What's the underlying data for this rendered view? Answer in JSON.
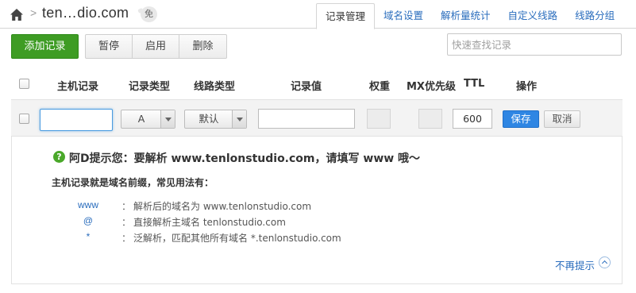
{
  "header": {
    "home_icon": "home-icon",
    "separator": ">",
    "domain": "ten…dio.com",
    "badge": "免",
    "tabs": [
      {
        "label": "记录管理",
        "active": true
      },
      {
        "label": "域名设置",
        "active": false
      },
      {
        "label": "解析量统计",
        "active": false
      },
      {
        "label": "自定义线路",
        "active": false
      },
      {
        "label": "线路分组",
        "active": false
      }
    ]
  },
  "toolbar": {
    "add_label": "添加记录",
    "pause_label": "暂停",
    "enable_label": "启用",
    "delete_label": "删除",
    "search_placeholder": "快速查找记录"
  },
  "table": {
    "headers": {
      "host": "主机记录",
      "type": "记录类型",
      "line": "线路类型",
      "value": "记录值",
      "weight": "权重",
      "mx": "MX优先级",
      "ttl": "TTL",
      "action": "操作"
    }
  },
  "edit_row": {
    "host_value": "",
    "record_type": "A",
    "line_type": "默认",
    "record_value": "",
    "ttl": "600",
    "save_label": "保存",
    "cancel_label": "取消"
  },
  "tip": {
    "icon": "question-icon",
    "title": "阿D提示您：要解析 www.tenlonstudio.com，请填写 www 哦～",
    "subtitle": "主机记录就是域名前缀，常见用法有：",
    "usages": [
      {
        "key": "www",
        "colon": "：",
        "desc": "解析后的域名为 www.tenlonstudio.com"
      },
      {
        "key": "@",
        "colon": "：",
        "desc": "直接解析主域名 tenlonstudio.com"
      },
      {
        "key": "*",
        "colon": "：",
        "desc": "泛解析，匹配其他所有域名 *.tenlonstudio.com"
      }
    ],
    "no_more_label": "不再提示",
    "collapse_icon": "chevron-up-icon"
  },
  "colors": {
    "accent_green": "#3e9c24",
    "accent_blue": "#2f86e3",
    "link_blue": "#2a6dbd"
  }
}
